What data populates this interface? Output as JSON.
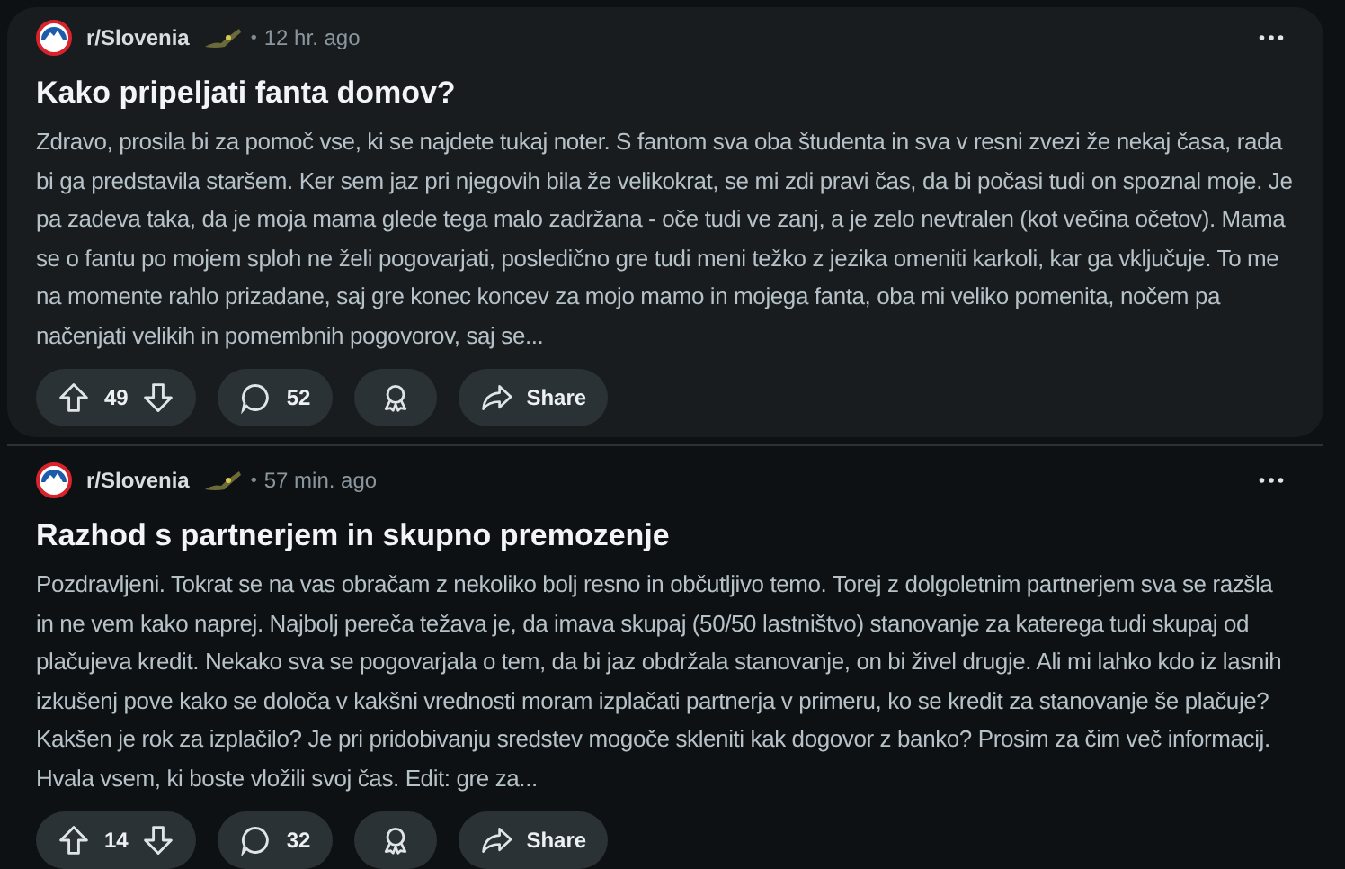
{
  "posts": [
    {
      "subreddit": "r/Slovenia",
      "separator": "•",
      "time": "12 hr. ago",
      "highlighted": true,
      "title": "Kako pripeljati fanta domov?",
      "body": "Zdravo, prosila bi za pomoč vse, ki se najdete tukaj noter. S fantom sva oba študenta in sva v resni zvezi že nekaj časa, rada bi ga predstavila staršem. Ker sem jaz pri njegovih bila že velikokrat, se mi zdi pravi čas, da bi počasi tudi on spoznal moje. Je pa zadeva taka, da je moja mama glede tega malo zadržana - oče tudi ve zanj, a je zelo nevtralen (kot večina očetov). Mama se o fantu po mojem sploh ne želi pogovarjati, posledično gre tudi meni težko z jezika omeniti karkoli, kar ga vključuje. To me na momente rahlo prizadane, saj gre konec koncev za mojo mamo in mojega fanta, oba mi veliko pomenita, nočem pa načenjati velikih in pomembnih pogovorov, saj se...",
      "votes": "49",
      "comments": "52",
      "share": "Share"
    },
    {
      "subreddit": "r/Slovenia",
      "separator": "•",
      "time": "57 min. ago",
      "highlighted": false,
      "title": "Razhod s partnerjem in skupno premozenje",
      "body": "Pozdravljeni. Tokrat se na vas obračam z nekoliko bolj resno in občutljivo temo. Torej z dolgoletnim partnerjem sva se razšla in ne vem kako naprej. Najbolj pereča težava je, da imava skupaj (50/50 lastništvo) stanovanje za katerega tudi skupaj od plačujeva kredit. Nekako sva se pogovarjala o tem, da bi jaz obdržala stanovanje, on bi živel drugje. Ali mi lahko kdo iz lasnih izkušenj pove kako se določa v kakšni vrednosti moram izplačati partnerja v primeru, ko se kredit za stanovanje še plačuje? Kakšen je rok za izplačilo? Je pri pridobivanju sredstev mogoče skleniti kak dogovor z banko? Prosim za čim več informacij. Hvala vsem, ki boste vložili svoj čas. Edit: gre za...",
      "votes": "14",
      "comments": "32",
      "share": "Share"
    }
  ]
}
